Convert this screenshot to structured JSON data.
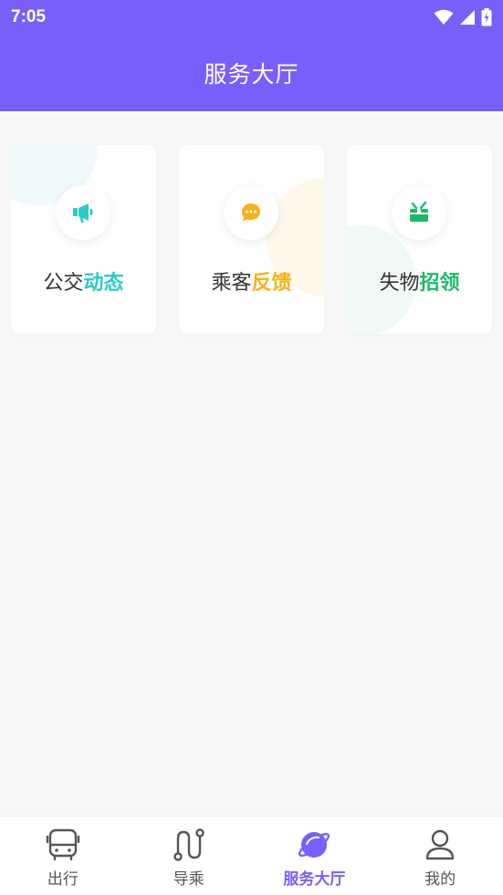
{
  "status_bar": {
    "time": "7:05",
    "icons": [
      "wifi-icon",
      "signal-icon",
      "battery-charging-icon"
    ]
  },
  "header": {
    "title": "服务大厅"
  },
  "colors": {
    "brand": "#7a5efc",
    "teal": "#2ecac4",
    "amber": "#f5b21c",
    "green": "#1fb86a"
  },
  "services": [
    {
      "prefix": "公交",
      "accent": "动态",
      "icon": "megaphone-icon",
      "accent_color": "#2ecac4"
    },
    {
      "prefix": "乘客",
      "accent": "反馈",
      "icon": "chat-bubble-icon",
      "accent_color": "#f5b21c"
    },
    {
      "prefix": "失物",
      "accent": "招领",
      "icon": "lost-found-box-icon",
      "accent_color": "#1fb86a"
    }
  ],
  "tabbar": {
    "items": [
      {
        "label": "出行",
        "icon": "bus-icon",
        "active": false
      },
      {
        "label": "导乘",
        "icon": "route-icon",
        "active": false
      },
      {
        "label": "服务大厅",
        "icon": "planet-icon",
        "active": true
      },
      {
        "label": "我的",
        "icon": "user-icon",
        "active": false
      }
    ]
  }
}
